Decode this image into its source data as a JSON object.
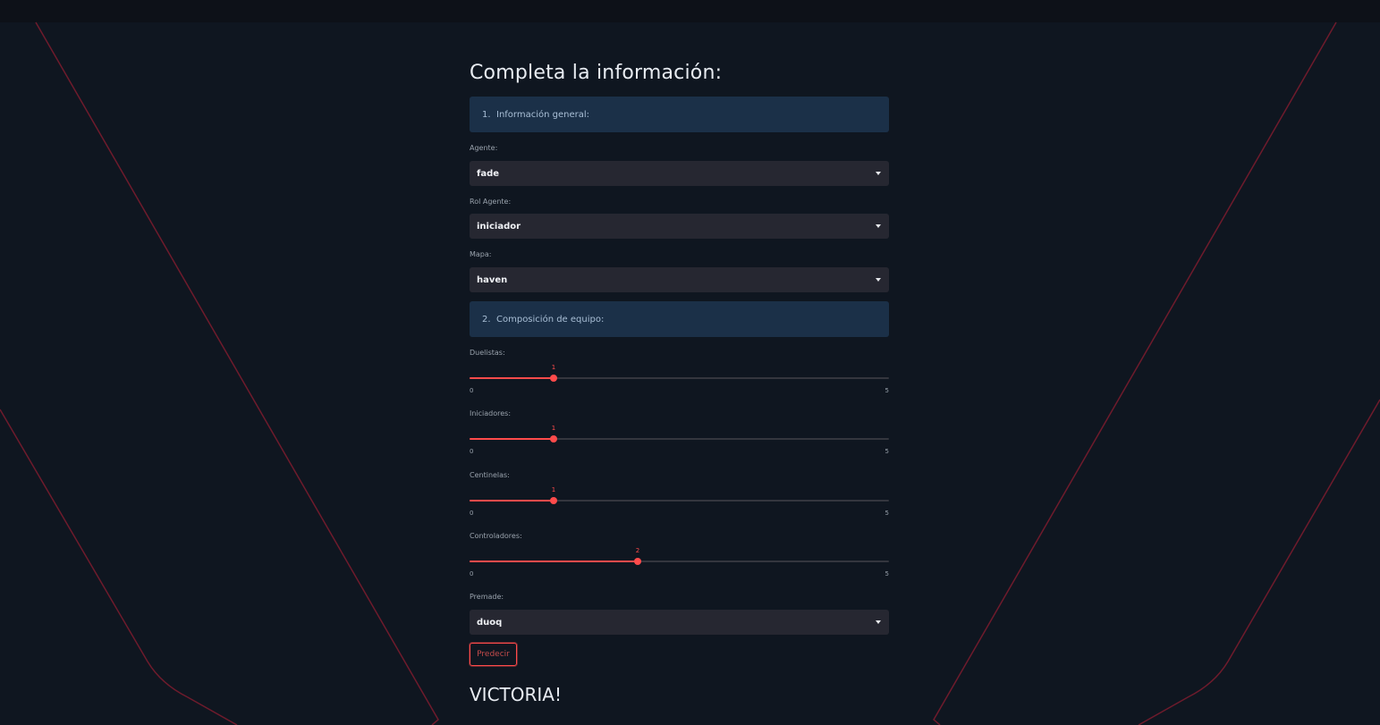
{
  "page": {
    "title": "Completa la información:",
    "result": "VICTORIA!"
  },
  "sections": [
    {
      "number": "1.",
      "label": "Información general:"
    },
    {
      "number": "2.",
      "label": "Composición de equipo:"
    }
  ],
  "fields": {
    "agente": {
      "label": "Agente:",
      "value": "fade"
    },
    "rol_agente": {
      "label": "Rol Agente:",
      "value": "iniciador"
    },
    "mapa": {
      "label": "Mapa:",
      "value": "haven"
    },
    "premade": {
      "label": "Premade:",
      "value": "duoq"
    }
  },
  "sliders": [
    {
      "label": "Duelistas:",
      "value": 1,
      "min": 0,
      "max": 5
    },
    {
      "label": "Iniciadores:",
      "value": 1,
      "min": 0,
      "max": 5
    },
    {
      "label": "Centinelas:",
      "value": 1,
      "min": 0,
      "max": 5
    },
    {
      "label": "Controladores:",
      "value": 2,
      "min": 0,
      "max": 5
    }
  ],
  "buttons": {
    "predict_label": "Predecir"
  },
  "colors": {
    "accent": "#ff4b4b",
    "section_bg": "#1b3048",
    "select_bg": "#262731",
    "background": "#0f1620"
  }
}
